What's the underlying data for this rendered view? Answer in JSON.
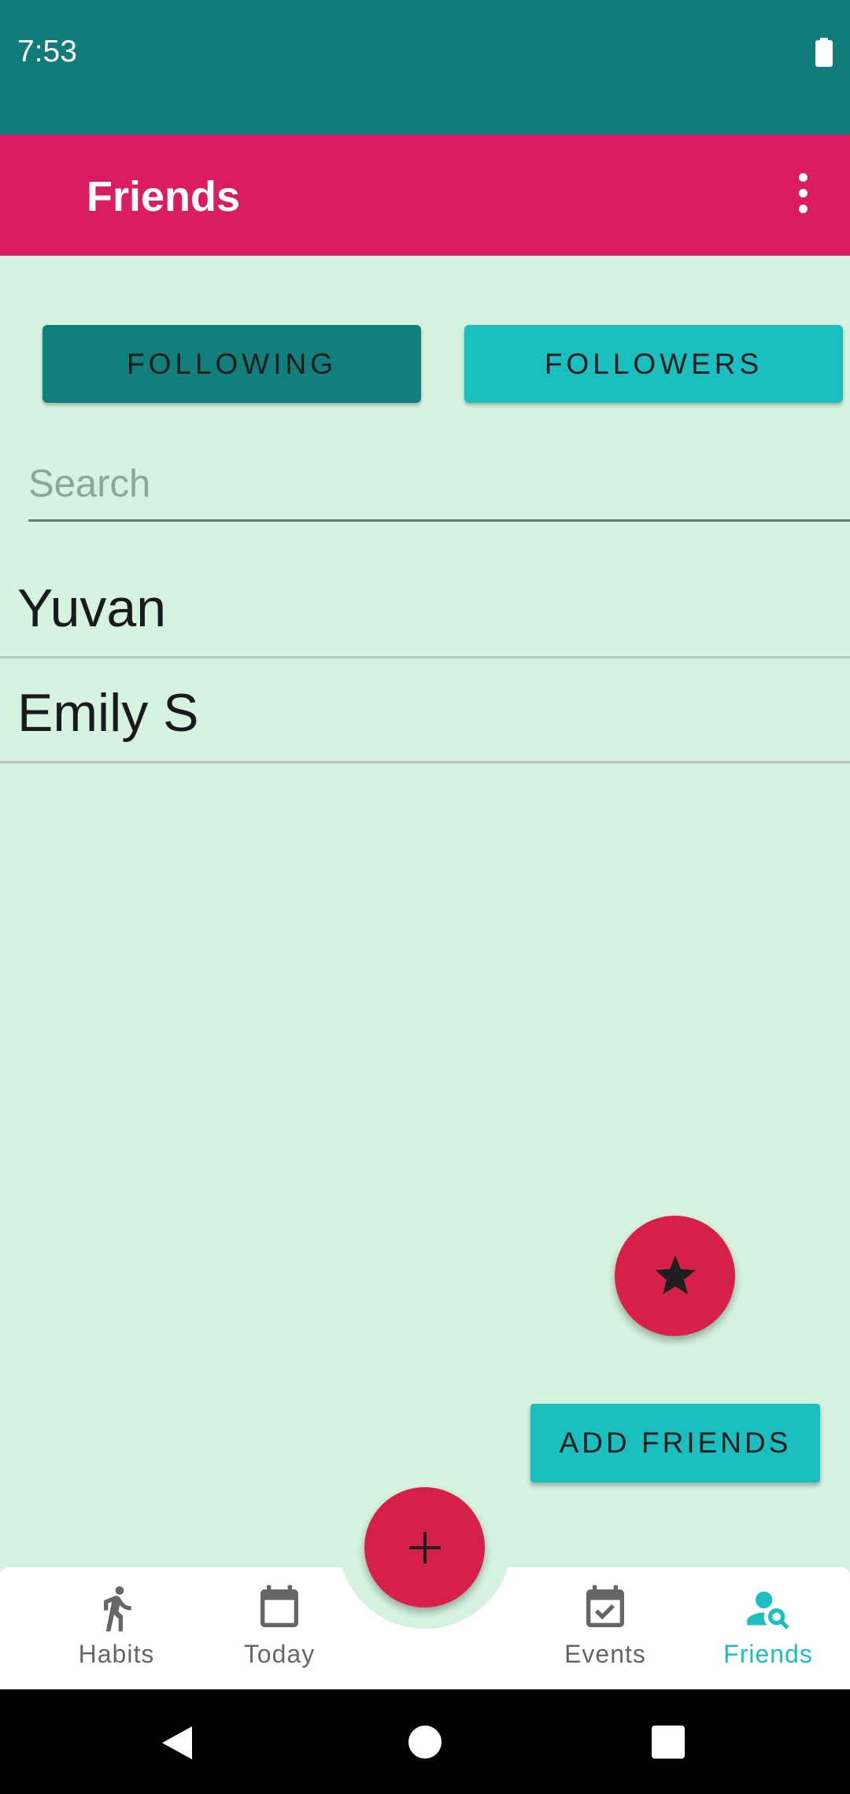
{
  "status_bar": {
    "time": "7:53"
  },
  "app_bar": {
    "title": "Friends"
  },
  "tabs": {
    "following": "FOLLOWING",
    "followers": "FOLLOWERS"
  },
  "search": {
    "placeholder": "Search",
    "value": ""
  },
  "friends": [
    {
      "name": "Yuvan"
    },
    {
      "name": "Emily S"
    }
  ],
  "buttons": {
    "add_friends": "ADD FRIENDS"
  },
  "bottom_nav": {
    "items": [
      {
        "label": "Habits",
        "icon": "run-icon"
      },
      {
        "label": "Today",
        "icon": "calendar-icon"
      },
      {
        "label": "Events",
        "icon": "event-check-icon"
      },
      {
        "label": "Friends",
        "icon": "person-search-icon",
        "active": true
      }
    ]
  },
  "colors": {
    "status_bar": "#107c7a",
    "app_bar": "#db1b62",
    "background": "#d5f3de",
    "accent": "#1bbfbf",
    "fab": "#d6204a"
  }
}
